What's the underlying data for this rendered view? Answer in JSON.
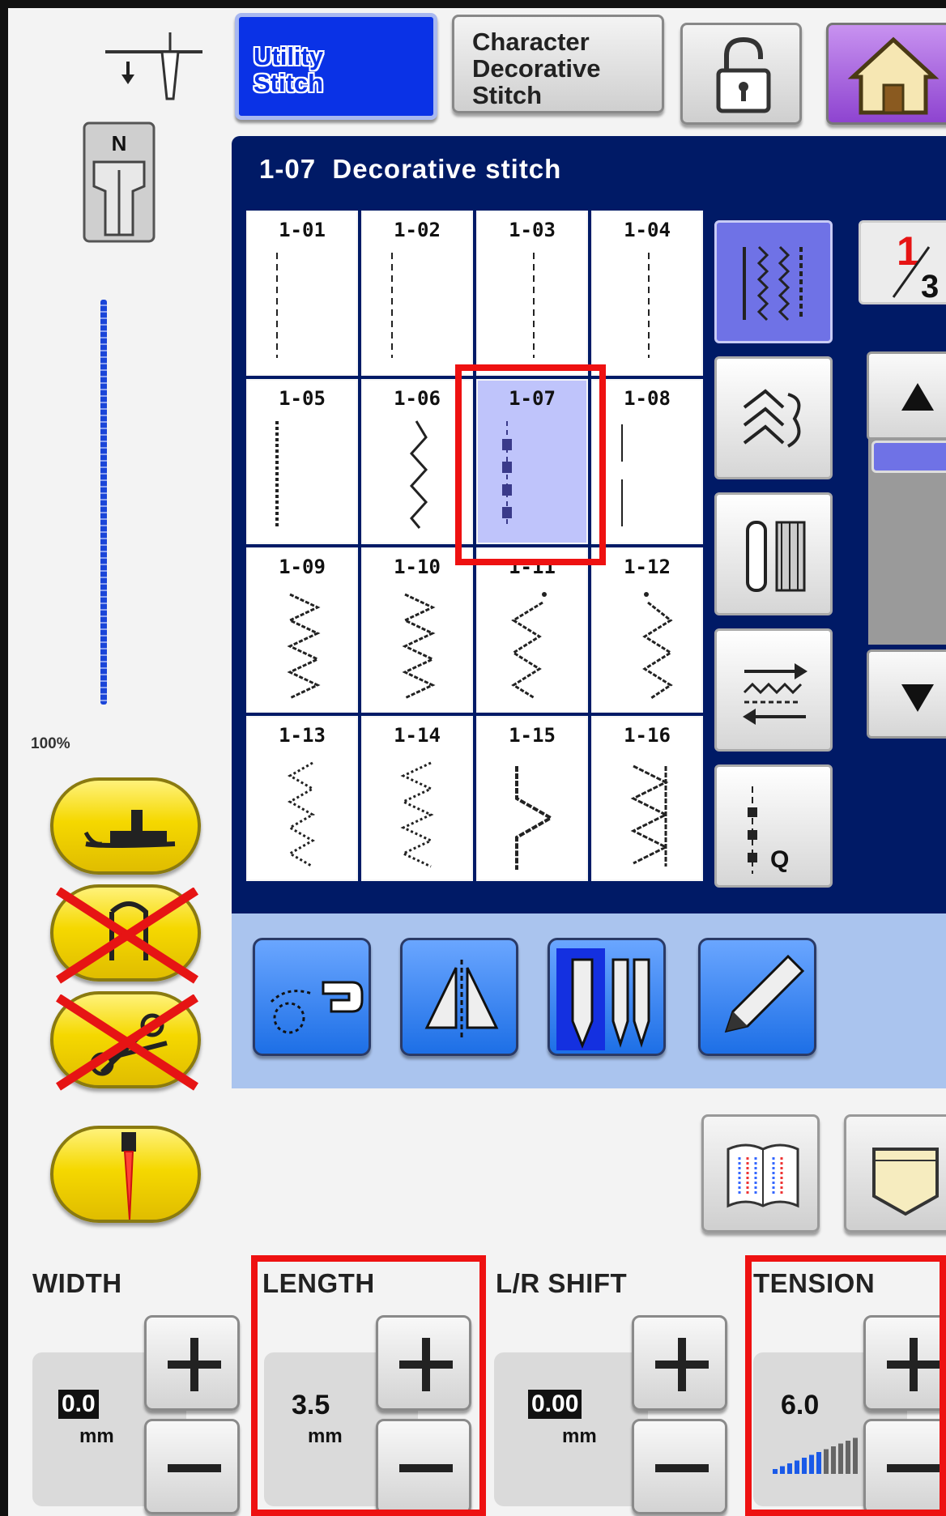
{
  "header": {
    "tabs": [
      {
        "label": "Utility\nStitch",
        "active": true
      },
      {
        "label": "Character\nDecorative\nStitch",
        "active": false
      }
    ]
  },
  "panel": {
    "title": "1-07  Decorative stitch",
    "page": {
      "current": "1",
      "total": "3"
    },
    "stitches": [
      {
        "code": "1-01"
      },
      {
        "code": "1-02"
      },
      {
        "code": "1-03"
      },
      {
        "code": "1-04"
      },
      {
        "code": "1-05"
      },
      {
        "code": "1-06"
      },
      {
        "code": "1-07",
        "selected": true
      },
      {
        "code": "1-08"
      },
      {
        "code": "1-09"
      },
      {
        "code": "1-10"
      },
      {
        "code": "1-11"
      },
      {
        "code": "1-12"
      },
      {
        "code": "1-13"
      },
      {
        "code": "1-14"
      },
      {
        "code": "1-15"
      },
      {
        "code": "1-16"
      }
    ],
    "category_icons": [
      "straight-stitch-icon",
      "decorative-stitch-icon",
      "buttonhole-icon",
      "reverse-stitch-icon",
      "quilting-stitch-icon"
    ],
    "quilt_label": "Q",
    "scroll_position": 0.0
  },
  "preview": {
    "zoom": "100%"
  },
  "settings": {
    "width": {
      "label": "WIDTH",
      "value": "0.0",
      "unit": "mm"
    },
    "length": {
      "label": "LENGTH",
      "value": "3.5",
      "unit": "mm"
    },
    "shift": {
      "label": "L/R SHIFT",
      "value": "0.00",
      "unit": "mm"
    },
    "tension": {
      "label": "TENSION",
      "value": "6.0",
      "level": 0.6
    }
  },
  "colors": {
    "panel": "#001a66",
    "active_tab": "#0a32e6",
    "selected_cell": "#bfc4fb",
    "highlight": "#ee1111",
    "yellow_button": "#f5d800",
    "home_button": "#9a50d8"
  }
}
